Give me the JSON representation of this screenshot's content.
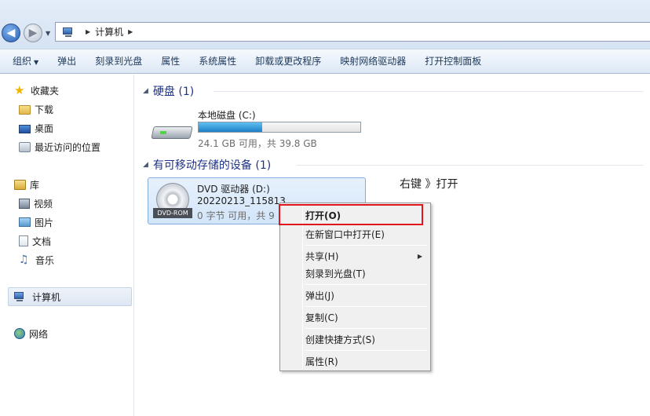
{
  "address": {
    "crumbs": [
      "计算机"
    ]
  },
  "toolbar": {
    "items": [
      "组织",
      "弹出",
      "刻录到光盘",
      "属性",
      "系统属性",
      "卸载或更改程序",
      "映射网络驱动器",
      "打开控制面板"
    ]
  },
  "sidebar": {
    "favorites": "收藏夹",
    "downloads": "下载",
    "desktop": "桌面",
    "recent": "最近访问的位置",
    "libraries": "库",
    "videos": "视频",
    "pictures": "图片",
    "documents": "文档",
    "music": "音乐",
    "computer": "计算机",
    "network": "网络"
  },
  "content": {
    "hdd_group": "硬盘 (1)",
    "removable_group": "有可移动存储的设备 (1)",
    "drive_c": {
      "name": "本地磁盘 (C:)",
      "free": "24.1 GB 可用，共 39.8 GB",
      "used_fraction": 0.395
    },
    "drive_d": {
      "name": "DVD 驱动器 (D:)",
      "volume": "20220213_115813",
      "free": "0 字节 可用，共 9",
      "icon_label": "DVD-ROM"
    },
    "annotation": "右键 》打开"
  },
  "context_menu": {
    "open": "打开(O)",
    "open_new_window": "在新窗口中打开(E)",
    "share": "共享(H)",
    "burn": "刻录到光盘(T)",
    "eject": "弹出(J)",
    "copy": "复制(C)",
    "create_shortcut": "创建快捷方式(S)",
    "properties": "属性(R)"
  },
  "colors": {
    "highlight_box": "#e0151e",
    "group_header": "#1e3287",
    "toolbar_text": "#1e395b"
  }
}
